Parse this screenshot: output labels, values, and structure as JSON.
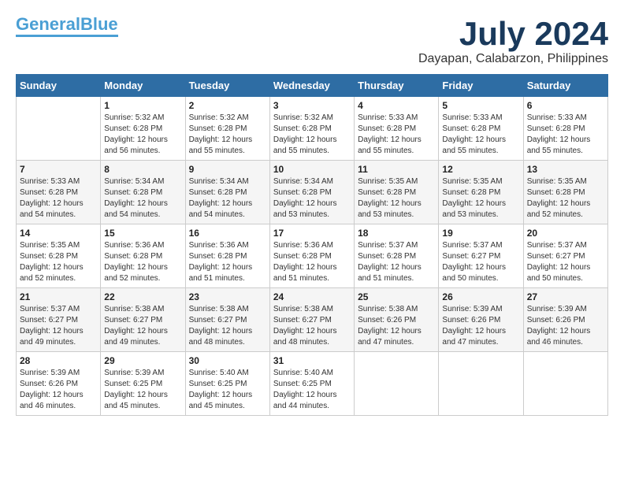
{
  "logo": {
    "general": "General",
    "blue": "Blue"
  },
  "header": {
    "month": "July 2024",
    "location": "Dayapan, Calabarzon, Philippines"
  },
  "days_of_week": [
    "Sunday",
    "Monday",
    "Tuesday",
    "Wednesday",
    "Thursday",
    "Friday",
    "Saturday"
  ],
  "weeks": [
    [
      {
        "day": "",
        "sunrise": "",
        "sunset": "",
        "daylight": ""
      },
      {
        "day": "1",
        "sunrise": "Sunrise: 5:32 AM",
        "sunset": "Sunset: 6:28 PM",
        "daylight": "Daylight: 12 hours and 56 minutes."
      },
      {
        "day": "2",
        "sunrise": "Sunrise: 5:32 AM",
        "sunset": "Sunset: 6:28 PM",
        "daylight": "Daylight: 12 hours and 55 minutes."
      },
      {
        "day": "3",
        "sunrise": "Sunrise: 5:32 AM",
        "sunset": "Sunset: 6:28 PM",
        "daylight": "Daylight: 12 hours and 55 minutes."
      },
      {
        "day": "4",
        "sunrise": "Sunrise: 5:33 AM",
        "sunset": "Sunset: 6:28 PM",
        "daylight": "Daylight: 12 hours and 55 minutes."
      },
      {
        "day": "5",
        "sunrise": "Sunrise: 5:33 AM",
        "sunset": "Sunset: 6:28 PM",
        "daylight": "Daylight: 12 hours and 55 minutes."
      },
      {
        "day": "6",
        "sunrise": "Sunrise: 5:33 AM",
        "sunset": "Sunset: 6:28 PM",
        "daylight": "Daylight: 12 hours and 55 minutes."
      }
    ],
    [
      {
        "day": "7",
        "sunrise": "Sunrise: 5:33 AM",
        "sunset": "Sunset: 6:28 PM",
        "daylight": "Daylight: 12 hours and 54 minutes."
      },
      {
        "day": "8",
        "sunrise": "Sunrise: 5:34 AM",
        "sunset": "Sunset: 6:28 PM",
        "daylight": "Daylight: 12 hours and 54 minutes."
      },
      {
        "day": "9",
        "sunrise": "Sunrise: 5:34 AM",
        "sunset": "Sunset: 6:28 PM",
        "daylight": "Daylight: 12 hours and 54 minutes."
      },
      {
        "day": "10",
        "sunrise": "Sunrise: 5:34 AM",
        "sunset": "Sunset: 6:28 PM",
        "daylight": "Daylight: 12 hours and 53 minutes."
      },
      {
        "day": "11",
        "sunrise": "Sunrise: 5:35 AM",
        "sunset": "Sunset: 6:28 PM",
        "daylight": "Daylight: 12 hours and 53 minutes."
      },
      {
        "day": "12",
        "sunrise": "Sunrise: 5:35 AM",
        "sunset": "Sunset: 6:28 PM",
        "daylight": "Daylight: 12 hours and 53 minutes."
      },
      {
        "day": "13",
        "sunrise": "Sunrise: 5:35 AM",
        "sunset": "Sunset: 6:28 PM",
        "daylight": "Daylight: 12 hours and 52 minutes."
      }
    ],
    [
      {
        "day": "14",
        "sunrise": "Sunrise: 5:35 AM",
        "sunset": "Sunset: 6:28 PM",
        "daylight": "Daylight: 12 hours and 52 minutes."
      },
      {
        "day": "15",
        "sunrise": "Sunrise: 5:36 AM",
        "sunset": "Sunset: 6:28 PM",
        "daylight": "Daylight: 12 hours and 52 minutes."
      },
      {
        "day": "16",
        "sunrise": "Sunrise: 5:36 AM",
        "sunset": "Sunset: 6:28 PM",
        "daylight": "Daylight: 12 hours and 51 minutes."
      },
      {
        "day": "17",
        "sunrise": "Sunrise: 5:36 AM",
        "sunset": "Sunset: 6:28 PM",
        "daylight": "Daylight: 12 hours and 51 minutes."
      },
      {
        "day": "18",
        "sunrise": "Sunrise: 5:37 AM",
        "sunset": "Sunset: 6:28 PM",
        "daylight": "Daylight: 12 hours and 51 minutes."
      },
      {
        "day": "19",
        "sunrise": "Sunrise: 5:37 AM",
        "sunset": "Sunset: 6:27 PM",
        "daylight": "Daylight: 12 hours and 50 minutes."
      },
      {
        "day": "20",
        "sunrise": "Sunrise: 5:37 AM",
        "sunset": "Sunset: 6:27 PM",
        "daylight": "Daylight: 12 hours and 50 minutes."
      }
    ],
    [
      {
        "day": "21",
        "sunrise": "Sunrise: 5:37 AM",
        "sunset": "Sunset: 6:27 PM",
        "daylight": "Daylight: 12 hours and 49 minutes."
      },
      {
        "day": "22",
        "sunrise": "Sunrise: 5:38 AM",
        "sunset": "Sunset: 6:27 PM",
        "daylight": "Daylight: 12 hours and 49 minutes."
      },
      {
        "day": "23",
        "sunrise": "Sunrise: 5:38 AM",
        "sunset": "Sunset: 6:27 PM",
        "daylight": "Daylight: 12 hours and 48 minutes."
      },
      {
        "day": "24",
        "sunrise": "Sunrise: 5:38 AM",
        "sunset": "Sunset: 6:27 PM",
        "daylight": "Daylight: 12 hours and 48 minutes."
      },
      {
        "day": "25",
        "sunrise": "Sunrise: 5:38 AM",
        "sunset": "Sunset: 6:26 PM",
        "daylight": "Daylight: 12 hours and 47 minutes."
      },
      {
        "day": "26",
        "sunrise": "Sunrise: 5:39 AM",
        "sunset": "Sunset: 6:26 PM",
        "daylight": "Daylight: 12 hours and 47 minutes."
      },
      {
        "day": "27",
        "sunrise": "Sunrise: 5:39 AM",
        "sunset": "Sunset: 6:26 PM",
        "daylight": "Daylight: 12 hours and 46 minutes."
      }
    ],
    [
      {
        "day": "28",
        "sunrise": "Sunrise: 5:39 AM",
        "sunset": "Sunset: 6:26 PM",
        "daylight": "Daylight: 12 hours and 46 minutes."
      },
      {
        "day": "29",
        "sunrise": "Sunrise: 5:39 AM",
        "sunset": "Sunset: 6:25 PM",
        "daylight": "Daylight: 12 hours and 45 minutes."
      },
      {
        "day": "30",
        "sunrise": "Sunrise: 5:40 AM",
        "sunset": "Sunset: 6:25 PM",
        "daylight": "Daylight: 12 hours and 45 minutes."
      },
      {
        "day": "31",
        "sunrise": "Sunrise: 5:40 AM",
        "sunset": "Sunset: 6:25 PM",
        "daylight": "Daylight: 12 hours and 44 minutes."
      },
      {
        "day": "",
        "sunrise": "",
        "sunset": "",
        "daylight": ""
      },
      {
        "day": "",
        "sunrise": "",
        "sunset": "",
        "daylight": ""
      },
      {
        "day": "",
        "sunrise": "",
        "sunset": "",
        "daylight": ""
      }
    ]
  ]
}
